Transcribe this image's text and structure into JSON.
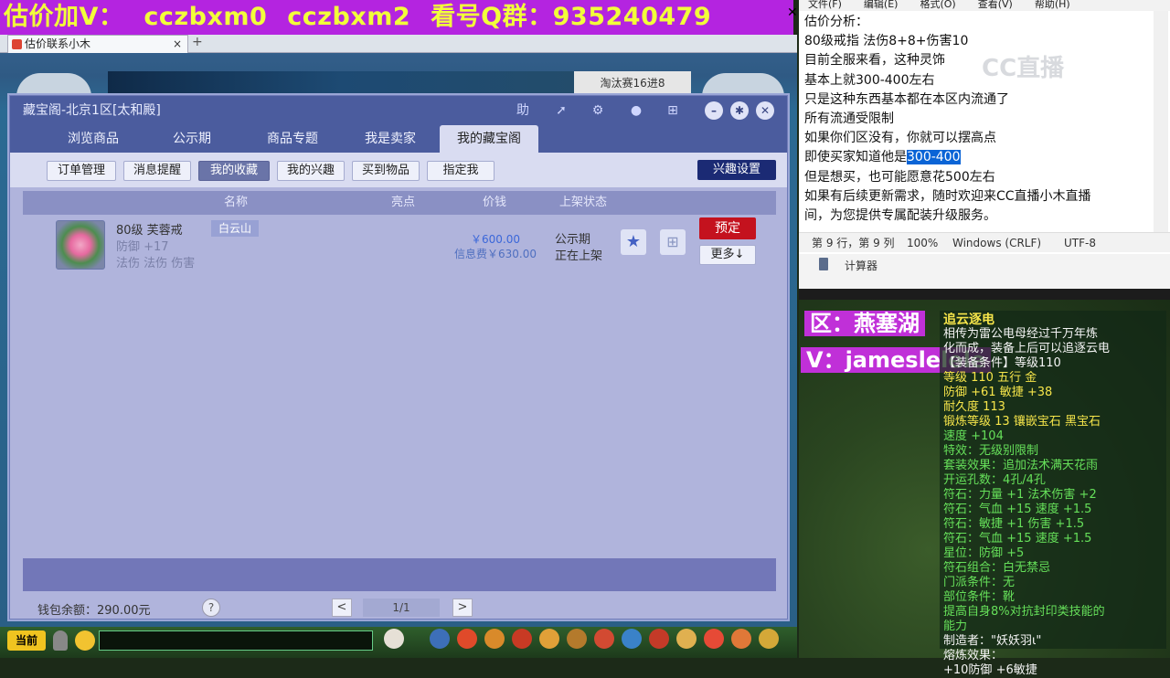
{
  "banner": {
    "text1": "估价加V：",
    "text2": "cczbxm0",
    "text3": "cczbxm2",
    "text4": "看号Q群：",
    "text5": "935240479"
  },
  "browser": {
    "tab_label": "估价联系小木",
    "close": "×",
    "new_tab": "+"
  },
  "game_top": {
    "right_label": "淘汰赛16进8"
  },
  "dialog": {
    "title": "藏宝阁-北京1区[太和殿]",
    "nav_tabs": [
      "浏览商品",
      "公示期",
      "商品专题",
      "我是卖家",
      "我的藏宝阁"
    ],
    "sub_tabs": [
      "订单管理",
      "消息提醒",
      "我的收藏",
      "我的兴趣",
      "买到物品",
      "指定我"
    ],
    "interest_button": "兴趣设置",
    "columns": [
      "名称",
      "亮点",
      "价钱",
      "上架状态"
    ],
    "item": {
      "name": "80级 芙蓉戒",
      "server_tag": "白云山",
      "line2": "防御 +17",
      "line3": "法伤 法伤 伤害",
      "price": "￥600.00",
      "credit_price": "信息费￥630.00",
      "status1": "公示期",
      "status2": "正在上架",
      "reserve": "预定",
      "more": "更多↓"
    },
    "wallet": "钱包余额：290.00元",
    "help": "?",
    "page": "1/1",
    "prev": "<",
    "next": ">"
  },
  "taskbar": {
    "current": "当前"
  },
  "notepad": {
    "menu": [
      "文件(F)",
      "编辑(E)",
      "格式(O)",
      "查看(V)",
      "帮助(H)"
    ],
    "lines": [
      "估价分析：",
      "80级戒指  法伤8+8+伤害10",
      "目前全服来看，这种灵饰",
      "基本上就300-400左右",
      "只是这种东西基本都在本区内流通了",
      "所有流通受限制",
      "如果你们区没有，你就可以摆高点",
      "即使买家知道他是",
      "但是想买，也可能愿意花500左右",
      "如果有后续更新需求，随时欢迎来CC直播小木直播",
      "间，为您提供专属配装升级服务。"
    ],
    "selected": "300-400",
    "status": {
      "pos": "第 9 行，第 9 列",
      "zoom": "100%",
      "eol": "Windows (CRLF)",
      "enc": "UTF-8"
    },
    "watermark": "CC直播"
  },
  "calculator": {
    "title": "计算器"
  },
  "overlay": {
    "zone": "区：燕塞湖",
    "v": "V：jameslelele"
  },
  "tooltip": {
    "name": "追云逐电",
    "desc1": "相传为雷公电母经过千万年炼",
    "desc2": "化而成，装备上后可以追逐云电",
    "req": "【装备条件】等级110",
    "lines": [
      "等级 110  五行 金",
      "防御 +61 敏捷 +38",
      "耐久度 113",
      "锻炼等级 13   镶嵌宝石 黑宝石",
      "速度 +104",
      "特效：无级别限制",
      "套装效果：追加法术满天花雨",
      "开运孔数：4孔/4孔",
      "符石：力量 +1 法术伤害 +2",
      "符石：气血 +15 速度 +1.5",
      "符石：敏捷 +1 伤害 +1.5",
      "符石：气血 +15 速度 +1.5",
      "星位：防御 +5",
      "符石组合：白无禁忌",
      "门派条件：无",
      "部位条件：靴",
      "提高自身8%对抗封印类技能的",
      "能力"
    ],
    "maker": "制造者：\"妖妖羽ι\"",
    "forge": "熔炼效果：",
    "forge2": "+10防御 +6敏捷"
  }
}
